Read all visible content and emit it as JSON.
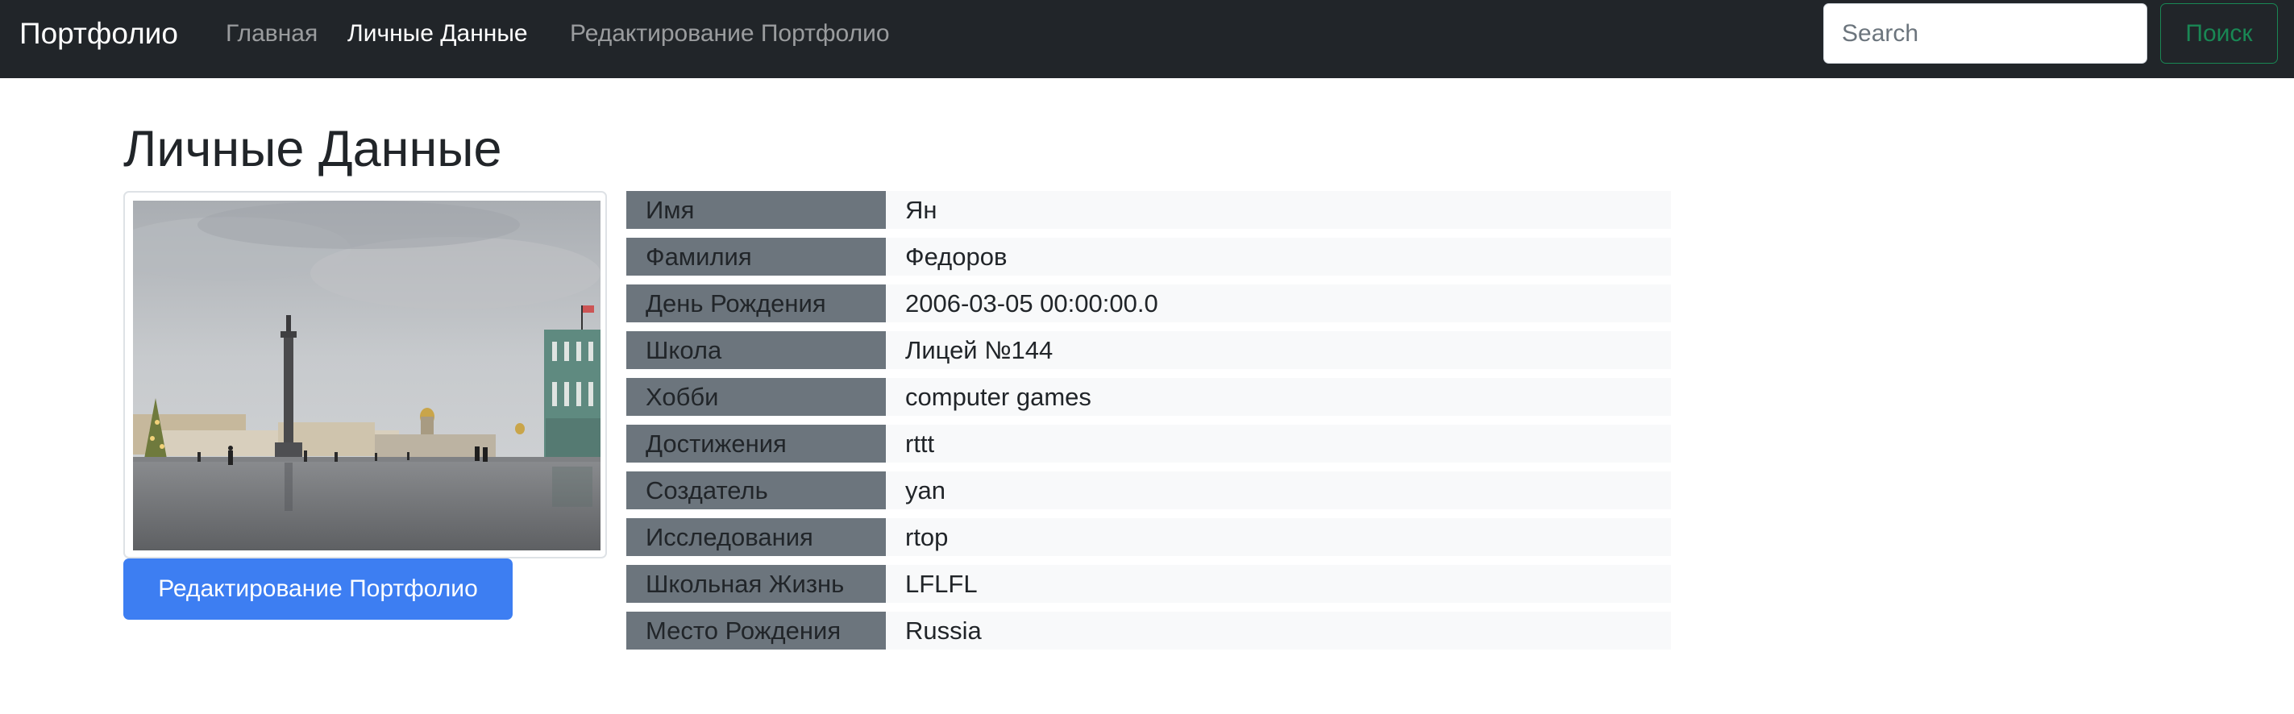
{
  "navbar": {
    "brand": "Портфолио",
    "links": [
      {
        "label": "Главная"
      },
      {
        "label": "Личные Данные"
      },
      {
        "label": "Редактирование Портфолио"
      }
    ],
    "search": {
      "placeholder": "Search",
      "value": ""
    },
    "search_button": "Поиск"
  },
  "main": {
    "title": "Личные Данные",
    "edit_button": "Редактирование Портфолио",
    "rows": [
      {
        "label": "Имя",
        "value": "Ян"
      },
      {
        "label": "Фамилия",
        "value": "Федоров"
      },
      {
        "label": "День Рождения",
        "value": "2006-03-05 00:00:00.0"
      },
      {
        "label": "Школа",
        "value": "Лицей №144"
      },
      {
        "label": "Хобби",
        "value": "computer games"
      },
      {
        "label": "Достижения",
        "value": "rttt"
      },
      {
        "label": "Создатель",
        "value": "yan"
      },
      {
        "label": "Исследования",
        "value": "rtop"
      },
      {
        "label": "Школьная Жизнь",
        "value": "LFLFL"
      },
      {
        "label": "Место Рождения",
        "value": "Russia"
      }
    ]
  },
  "colors": {
    "navbar_bg": "#212529",
    "search_accent": "#198754",
    "primary_button": "#3d7ef2",
    "label_bg": "#6c757d",
    "value_bg": "#f8f9fa"
  }
}
